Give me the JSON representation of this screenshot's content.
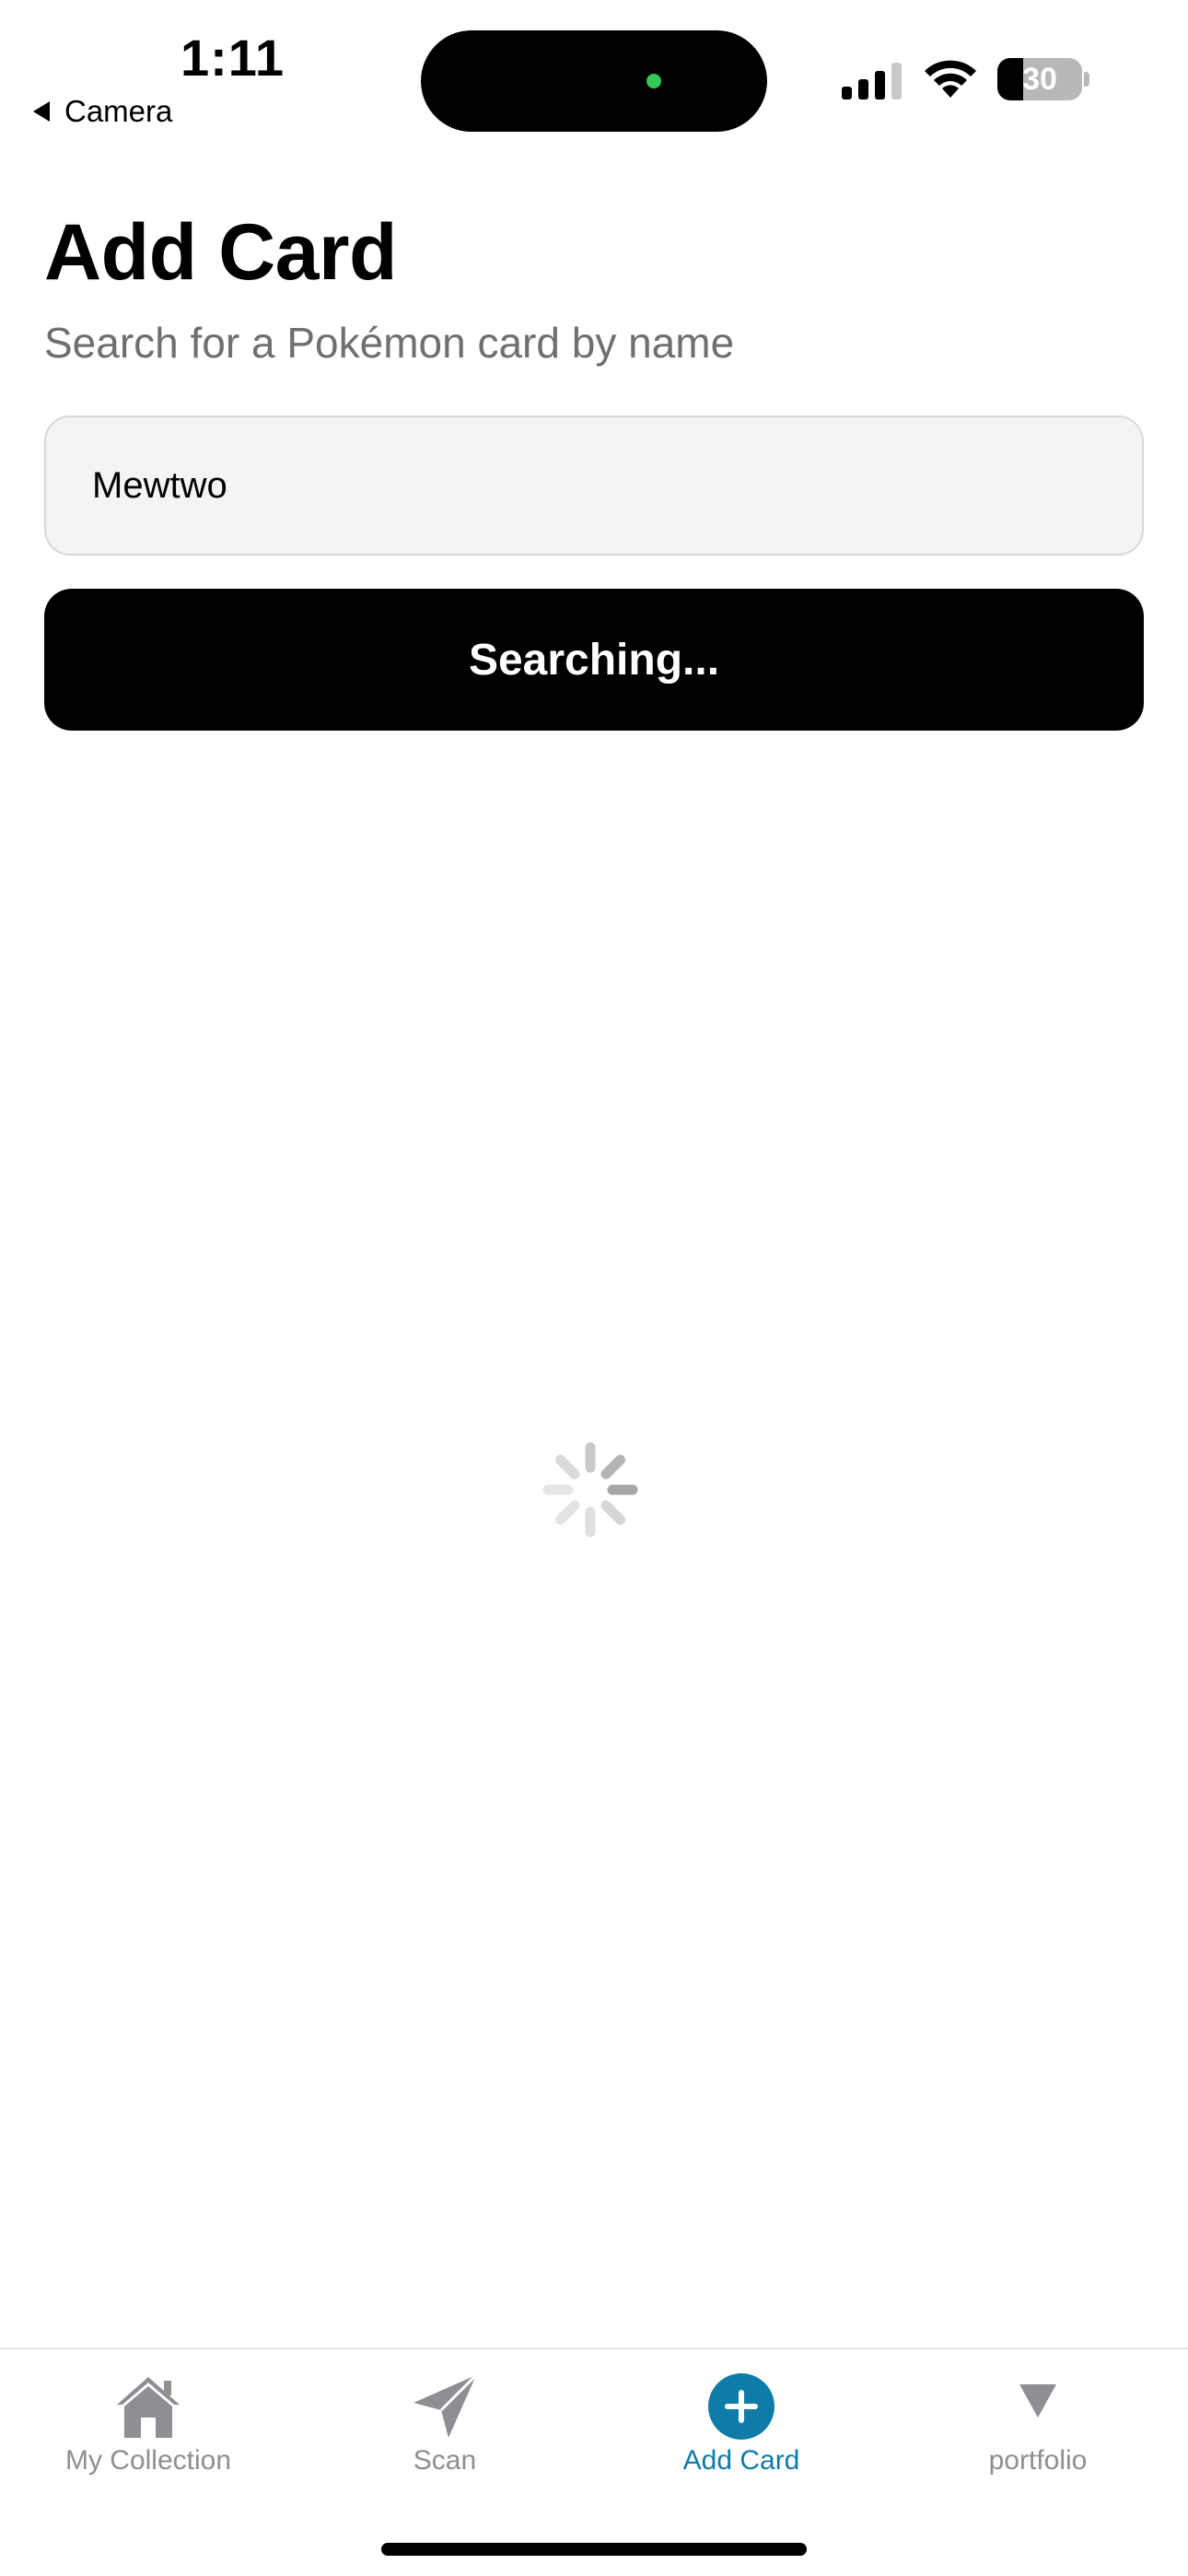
{
  "status_bar": {
    "time": "1:11",
    "back_label": "Camera",
    "battery_level": "30",
    "battery_fraction": 0.3
  },
  "header": {
    "title": "Add Card",
    "subtitle": "Search for a Pokémon card by name"
  },
  "search": {
    "value": "Mewtwo",
    "button_label": "Searching..."
  },
  "tabs": [
    {
      "label": "My Collection",
      "icon": "house-icon",
      "active": false
    },
    {
      "label": "Scan",
      "icon": "paperplane-icon",
      "active": false
    },
    {
      "label": "Add Card",
      "icon": "plus-circle-icon",
      "active": true
    },
    {
      "label": "portfolio",
      "icon": "triangle-down-icon",
      "active": false
    }
  ],
  "colors": {
    "accent": "#0f7ca8",
    "inactive": "#8e8e93",
    "button_bg": "#000000",
    "input_bg": "#f4f4f4"
  }
}
